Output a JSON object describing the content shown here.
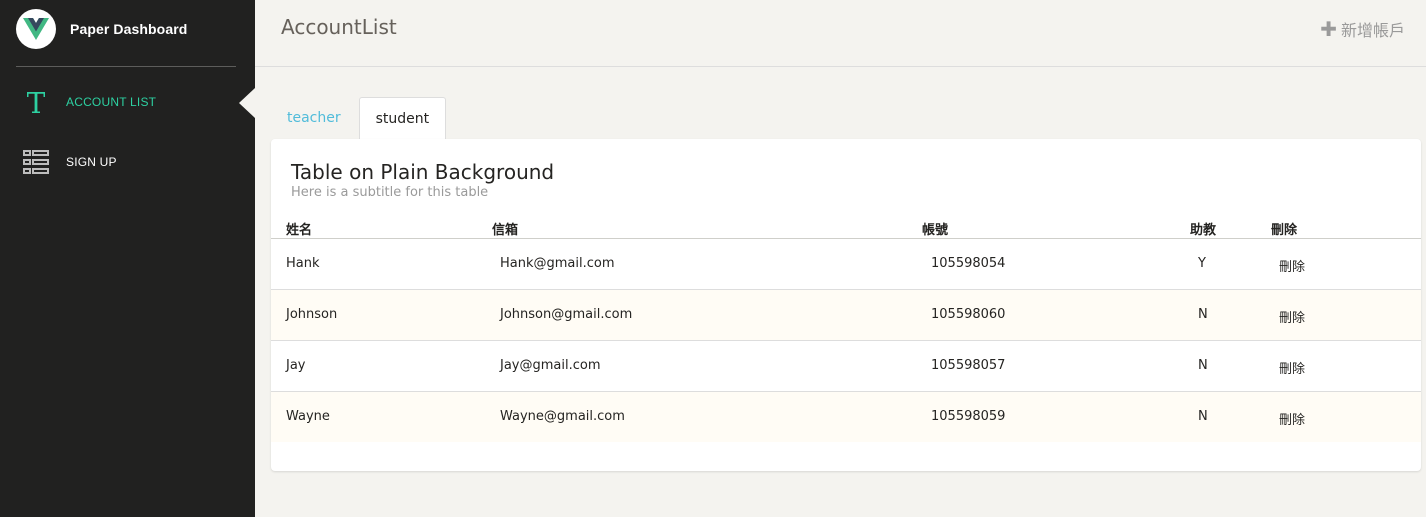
{
  "brand": {
    "name": "Paper Dashboard",
    "logo_icon": "vue-logo-icon"
  },
  "sidebar": {
    "items": [
      {
        "label": "ACCOUNT LIST",
        "icon": "text-t-icon",
        "active": true
      },
      {
        "label": "SIGN UP",
        "icon": "view-list-icon",
        "active": false
      }
    ]
  },
  "header": {
    "title": "AccountList",
    "add_label": "新增帳戶",
    "add_icon": "plus-icon"
  },
  "tabs": [
    {
      "label": "teacher",
      "active": false
    },
    {
      "label": "student",
      "active": true
    }
  ],
  "card": {
    "title": "Table on Plain Background",
    "subtitle": "Here is a subtitle for this table"
  },
  "table": {
    "columns": [
      "姓名",
      "信箱",
      "帳號",
      "助教",
      "刪除"
    ],
    "rows": [
      {
        "name": "Hank",
        "email": "Hank@gmail.com",
        "account": "105598054",
        "ta": "Y",
        "delete": "刪除"
      },
      {
        "name": "Johnson",
        "email": "Johnson@gmail.com",
        "account": "105598060",
        "ta": "N",
        "delete": "刪除"
      },
      {
        "name": "Jay",
        "email": "Jay@gmail.com",
        "account": "105598057",
        "ta": "N",
        "delete": "刪除"
      },
      {
        "name": "Wayne",
        "email": "Wayne@gmail.com",
        "account": "105598059",
        "ta": "N",
        "delete": "刪除"
      }
    ]
  },
  "colors": {
    "sidebar_bg": "#212120",
    "accent": "#2dd0a1",
    "tab_link": "#51bcda",
    "page_bg": "#f4f3ef"
  }
}
